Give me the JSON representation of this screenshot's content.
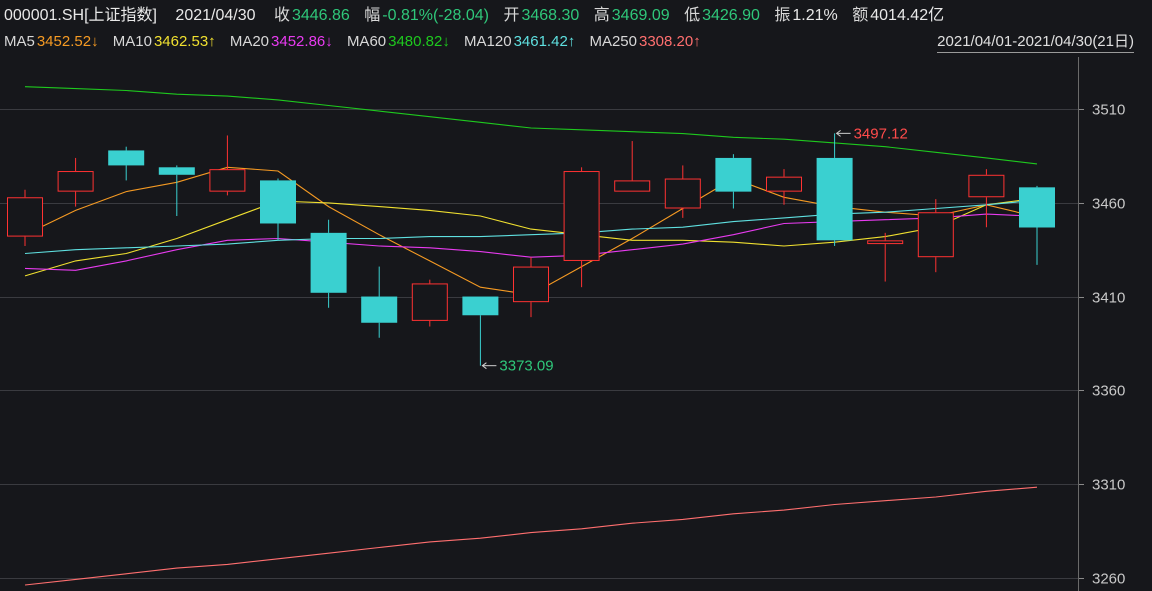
{
  "info": {
    "symbol": "000001.SH[上证指数]",
    "date": "2021/04/30",
    "close_label": "收",
    "close_value": "3446.86",
    "change_label": "幅",
    "change_value": "-0.81%(-28.04)",
    "open_label": "开",
    "open_value": "3468.30",
    "high_label": "高",
    "high_value": "3469.09",
    "low_label": "低",
    "low_value": "3426.90",
    "amplitude_label": "振",
    "amplitude_value": "1.21%",
    "amount_label": "额",
    "amount_value": "4014.42亿"
  },
  "ma_bar": {
    "items": [
      {
        "label": "MA5",
        "value": "3452.52↓",
        "color": "#f59a23"
      },
      {
        "label": "MA10",
        "value": "3462.53↑",
        "color": "#f0e030"
      },
      {
        "label": "MA20",
        "value": "3452.86↓",
        "color": "#e83bf0"
      },
      {
        "label": "MA60",
        "value": "3480.82↓",
        "color": "#1ec91e"
      },
      {
        "label": "MA120",
        "value": "3461.42↑",
        "color": "#5fe0e0"
      },
      {
        "label": "MA250",
        "value": "3308.20↑",
        "color": "#ff6f6f"
      }
    ],
    "date_range": "2021/04/01-2021/04/30(21日)"
  },
  "chart_data": {
    "type": "candlestick",
    "ylim": [
      3250,
      3535
    ],
    "y_ticks": [
      3510,
      3460,
      3410,
      3360,
      3310,
      3260
    ],
    "colors": {
      "up": "#ff3232",
      "down": "#3ad0d0",
      "grid": "#3a3b40",
      "tick_text": "#c8c8c8"
    },
    "candles": [
      {
        "date": "2021/04/01",
        "open": 3442,
        "close": 3463,
        "high": 3467,
        "low": 3437
      },
      {
        "date": "2021/04/02",
        "open": 3466,
        "close": 3477,
        "high": 3484,
        "low": 3458
      },
      {
        "date": "2021/04/06",
        "open": 3488,
        "close": 3480,
        "high": 3490,
        "low": 3472
      },
      {
        "date": "2021/04/07",
        "open": 3479,
        "close": 3475,
        "high": 3480,
        "low": 3453
      },
      {
        "date": "2021/04/08",
        "open": 3466,
        "close": 3478,
        "high": 3496,
        "low": 3464
      },
      {
        "date": "2021/04/09",
        "open": 3472,
        "close": 3449,
        "high": 3473,
        "low": 3440
      },
      {
        "date": "2021/04/12",
        "open": 3444,
        "close": 3412,
        "high": 3451,
        "low": 3404
      },
      {
        "date": "2021/04/13",
        "open": 3410,
        "close": 3396,
        "high": 3426,
        "low": 3388
      },
      {
        "date": "2021/04/14",
        "open": 3397,
        "close": 3417,
        "high": 3419,
        "low": 3394
      },
      {
        "date": "2021/04/15",
        "open": 3410,
        "close": 3400,
        "high": 3410,
        "low": 3373.09
      },
      {
        "date": "2021/04/16",
        "open": 3407,
        "close": 3426,
        "high": 3431,
        "low": 3399
      },
      {
        "date": "2021/04/19",
        "open": 3429,
        "close": 3477,
        "high": 3479,
        "low": 3415
      },
      {
        "date": "2021/04/20",
        "open": 3466,
        "close": 3472,
        "high": 3493,
        "low": 3466
      },
      {
        "date": "2021/04/21",
        "open": 3457,
        "close": 3473,
        "high": 3480,
        "low": 3452
      },
      {
        "date": "2021/04/22",
        "open": 3484,
        "close": 3466,
        "high": 3486,
        "low": 3457
      },
      {
        "date": "2021/04/23",
        "open": 3466,
        "close": 3474,
        "high": 3478,
        "low": 3459
      },
      {
        "date": "2021/04/26",
        "open": 3484,
        "close": 3440,
        "high": 3497.12,
        "low": 3437
      },
      {
        "date": "2021/04/27",
        "open": 3438,
        "close": 3440,
        "high": 3444,
        "low": 3418
      },
      {
        "date": "2021/04/28",
        "open": 3431,
        "close": 3455,
        "high": 3462,
        "low": 3423
      },
      {
        "date": "2021/04/29",
        "open": 3463,
        "close": 3475,
        "high": 3478,
        "low": 3447
      },
      {
        "date": "2021/04/30",
        "open": 3468.3,
        "close": 3446.86,
        "high": 3469.09,
        "low": 3426.9
      }
    ],
    "ma_lines": [
      {
        "name": "MA5",
        "color": "#f59a23",
        "values": [
          3443,
          3456,
          3466,
          3471,
          3479,
          3477,
          3458,
          3443,
          3429,
          3415,
          3411,
          3426,
          3441,
          3457,
          3473,
          3463,
          3458,
          3455,
          3453,
          3459,
          3452.52
        ]
      },
      {
        "name": "MA10",
        "color": "#f0e030",
        "values": [
          3421,
          3429,
          3433,
          3441,
          3451,
          3461,
          3460,
          3458,
          3456,
          3453,
          3446,
          3443,
          3440,
          3440,
          3439,
          3437,
          3439,
          3442,
          3447,
          3459,
          3462.53
        ]
      },
      {
        "name": "MA20",
        "color": "#e83bf0",
        "values": [
          3425,
          3424,
          3429,
          3435,
          3440,
          3441,
          3439,
          3437,
          3436,
          3434,
          3431,
          3432,
          3435,
          3438,
          3443,
          3449,
          3450,
          3451,
          3452,
          3454,
          3452.86
        ]
      },
      {
        "name": "MA60",
        "color": "#1ec91e",
        "values": [
          3522,
          3521,
          3520,
          3518,
          3517,
          3515,
          3512,
          3509,
          3506,
          3503,
          3500,
          3499,
          3498,
          3497,
          3495,
          3494,
          3492,
          3490,
          3487,
          3484,
          3480.82
        ]
      },
      {
        "name": "MA120",
        "color": "#5fe0e0",
        "values": [
          3433,
          3435,
          3436,
          3437,
          3438,
          3440,
          3441,
          3441,
          3442,
          3442,
          3443,
          3444,
          3446,
          3447,
          3450,
          3452,
          3454,
          3455,
          3457,
          3459,
          3461.42
        ]
      },
      {
        "name": "MA250",
        "color": "#ff6f6f",
        "values": [
          3256,
          3259,
          3262,
          3265,
          3267,
          3270,
          3273,
          3276,
          3279,
          3281,
          3284,
          3286,
          3289,
          3291,
          3294,
          3296,
          3299,
          3301,
          3303,
          3306,
          3308.2
        ]
      }
    ],
    "annotations": [
      {
        "text": "3497.12",
        "index": 16,
        "value": 3497.12,
        "color": "#ff4b4b"
      },
      {
        "text": "3373.09",
        "index": 9,
        "value": 3373.09,
        "color": "#2fc77a"
      }
    ]
  }
}
